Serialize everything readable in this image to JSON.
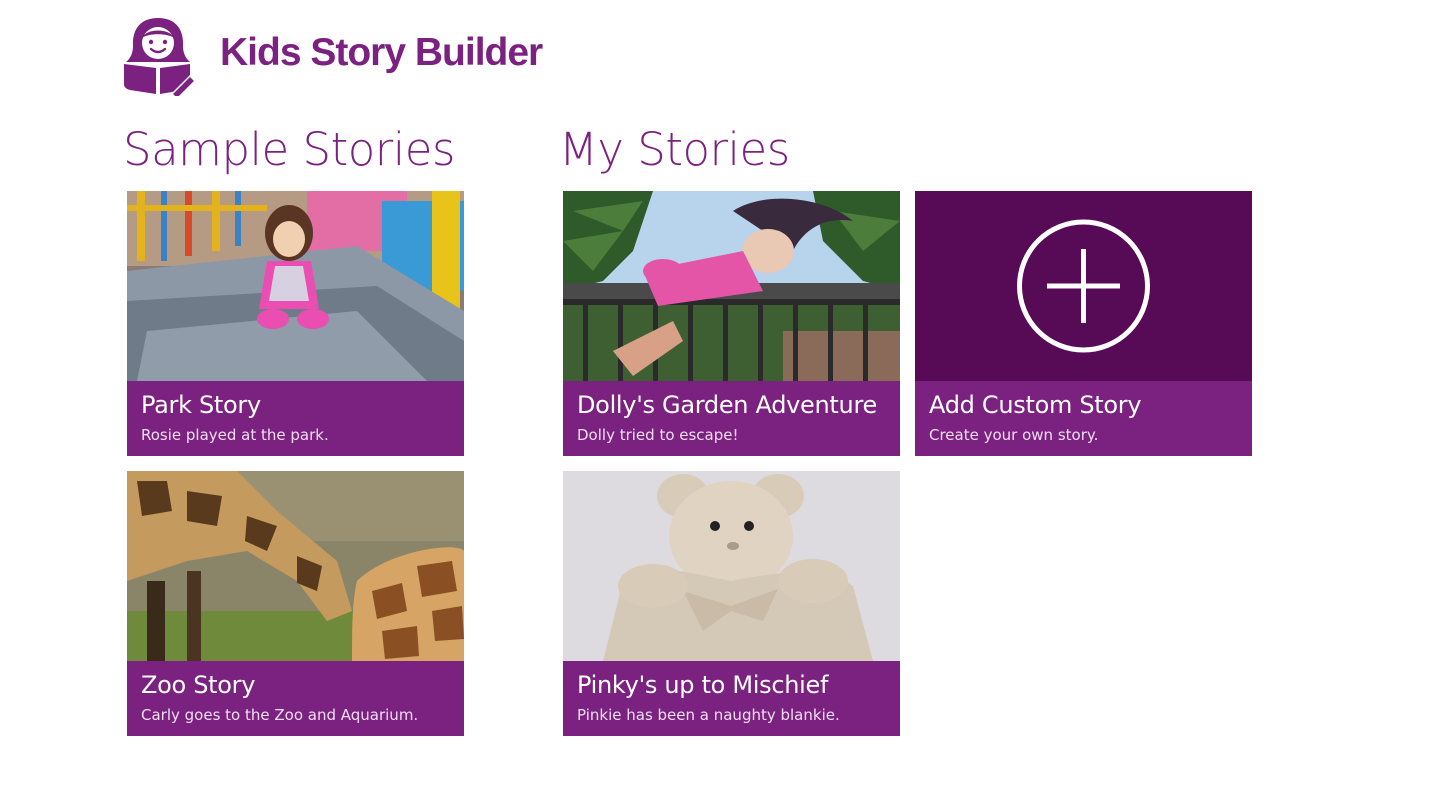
{
  "app": {
    "title": "Kids Story Builder",
    "logo_icon": "girl-reading-book-icon",
    "accent_color": "#7b2180",
    "add_tile_color": "#570a55"
  },
  "sections": {
    "sample": {
      "heading": "Sample Stories",
      "stories": [
        {
          "title": "Park Story",
          "subtitle": "Rosie played at the park.",
          "image": "doll-on-playground-slide"
        },
        {
          "title": "Zoo Story",
          "subtitle": "Carly goes to the Zoo and Aquarium.",
          "image": "giraffes"
        }
      ]
    },
    "my": {
      "heading": "My Stories",
      "stories": [
        {
          "title": "Dolly's Garden Adventure",
          "subtitle": "Dolly tried to escape!",
          "image": "doll-on-garden-fence"
        },
        {
          "title": "Pinky's up to Mischief",
          "subtitle": "Pinkie has been a naughty blankie.",
          "image": "teddy-bear-blankie"
        }
      ],
      "add_tile": {
        "title": "Add Custom Story",
        "subtitle": "Create your own story.",
        "icon": "plus-circle-icon"
      }
    }
  }
}
